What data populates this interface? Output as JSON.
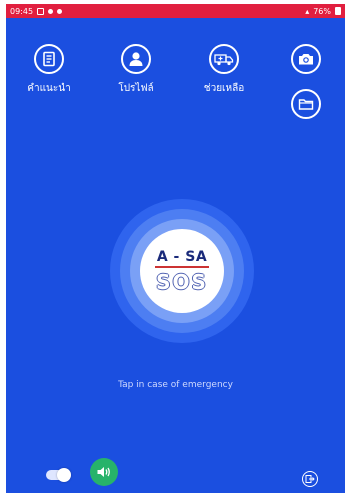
{
  "statusbar": {
    "time": "09:45",
    "battery": "76%"
  },
  "toolbar": {
    "guide_label": "คำแนะนำ",
    "profile_label": "โปรไฟล์",
    "help_label": "ช่วยเหลือ"
  },
  "sos": {
    "logo_top": "A - SA",
    "logo_bottom": "SOS"
  },
  "hint": "Tap in case of emergency",
  "colors": {
    "background": "#1b4fe0",
    "statusbar": "#e11f3f",
    "speaker": "#27b36a"
  },
  "controls": {
    "toggle_on": true
  }
}
